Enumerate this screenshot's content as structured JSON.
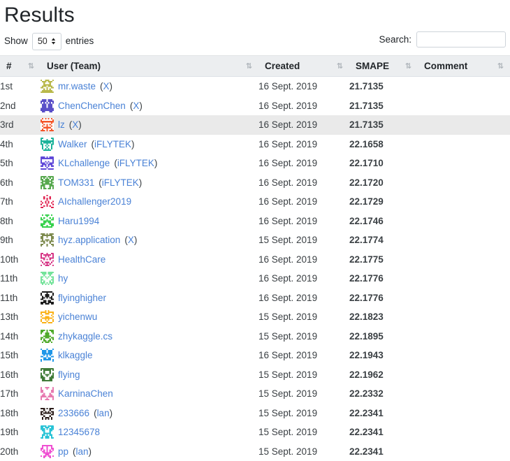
{
  "page_title": "Results",
  "controls": {
    "show_label": "Show",
    "entries_label": "entries",
    "page_length": "50",
    "search_label": "Search:",
    "search_value": "",
    "search_placeholder": ""
  },
  "table": {
    "columns": [
      {
        "key": "rank",
        "label": "#"
      },
      {
        "key": "user",
        "label": "User (Team)"
      },
      {
        "key": "created",
        "label": "Created"
      },
      {
        "key": "smape",
        "label": "SMAPE"
      },
      {
        "key": "comment",
        "label": "Comment"
      }
    ],
    "sort_icon": "⇅",
    "rows": [
      {
        "rank": "1st",
        "user": "mr.waste",
        "team": "X",
        "created": "16 Sept. 2019",
        "smape": "21.7135",
        "comment": "",
        "avatar_color": "#b8b84a",
        "highlight": false
      },
      {
        "rank": "2nd",
        "user": "ChenChenChen",
        "team": "X",
        "created": "16 Sept. 2019",
        "smape": "21.7135",
        "comment": "",
        "avatar_color": "#5a4fc8",
        "highlight": false
      },
      {
        "rank": "3rd",
        "user": "lz",
        "team": "X",
        "created": "16 Sept. 2019",
        "smape": "21.7135",
        "comment": "",
        "avatar_color": "#f4562a",
        "highlight": true
      },
      {
        "rank": "4th",
        "user": "Walker",
        "team": "iFLYTEK",
        "created": "16 Sept. 2019",
        "smape": "22.1658",
        "comment": "",
        "avatar_color": "#1bb39a",
        "highlight": false
      },
      {
        "rank": "5th",
        "user": "KLchallenge",
        "team": "iFLYTEK",
        "created": "16 Sept. 2019",
        "smape": "22.1710",
        "comment": "",
        "avatar_color": "#5f48d8",
        "highlight": false
      },
      {
        "rank": "6th",
        "user": "TOM331",
        "team": "iFLYTEK",
        "created": "16 Sept. 2019",
        "smape": "22.1720",
        "comment": "",
        "avatar_color": "#57a84e",
        "highlight": false
      },
      {
        "rank": "7th",
        "user": "AIchallenger2019",
        "team": "",
        "created": "16 Sept. 2019",
        "smape": "22.1729",
        "comment": "",
        "avatar_color": "#e0214f",
        "highlight": false
      },
      {
        "rank": "8th",
        "user": "Haru1994",
        "team": "",
        "created": "16 Sept. 2019",
        "smape": "22.1746",
        "comment": "",
        "avatar_color": "#35d14b",
        "highlight": false
      },
      {
        "rank": "9th",
        "user": "hyz.application",
        "team": "X",
        "created": "15 Sept. 2019",
        "smape": "22.1774",
        "comment": "",
        "avatar_color": "#7d8a4e",
        "highlight": false
      },
      {
        "rank": "10th",
        "user": "HealthCare",
        "team": "",
        "created": "16 Sept. 2019",
        "smape": "22.1775",
        "comment": "",
        "avatar_color": "#d63384",
        "highlight": false
      },
      {
        "rank": "11th",
        "user": "hy",
        "team": "",
        "created": "16 Sept. 2019",
        "smape": "22.1776",
        "comment": "",
        "avatar_color": "#74e39a",
        "highlight": false
      },
      {
        "rank": "11th",
        "user": "flyinghigher",
        "team": "",
        "created": "16 Sept. 2019",
        "smape": "22.1776",
        "comment": "",
        "avatar_color": "#1c1c1c",
        "highlight": false
      },
      {
        "rank": "13th",
        "user": "yichenwu",
        "team": "",
        "created": "15 Sept. 2019",
        "smape": "22.1823",
        "comment": "",
        "avatar_color": "#fbb216",
        "highlight": false
      },
      {
        "rank": "14th",
        "user": "zhykaggle.cs",
        "team": "",
        "created": "15 Sept. 2019",
        "smape": "22.1895",
        "comment": "",
        "avatar_color": "#4faa2a",
        "highlight": false
      },
      {
        "rank": "15th",
        "user": "klkaggle",
        "team": "",
        "created": "16 Sept. 2019",
        "smape": "22.1943",
        "comment": "",
        "avatar_color": "#1e96e8",
        "highlight": false
      },
      {
        "rank": "16th",
        "user": "flying",
        "team": "",
        "created": "15 Sept. 2019",
        "smape": "22.1962",
        "comment": "",
        "avatar_color": "#3f7a38",
        "highlight": false
      },
      {
        "rank": "17th",
        "user": "KarninaChen",
        "team": "",
        "created": "15 Sept. 2019",
        "smape": "22.2332",
        "comment": "",
        "avatar_color": "#e77ab0",
        "highlight": false
      },
      {
        "rank": "18th",
        "user": "233666",
        "team": "lan",
        "created": "15 Sept. 2019",
        "smape": "22.2341",
        "comment": "",
        "avatar_color": "#2b1d1a",
        "highlight": false
      },
      {
        "rank": "19th",
        "user": "12345678",
        "team": "",
        "created": "15 Sept. 2019",
        "smape": "22.2341",
        "comment": "",
        "avatar_color": "#29c3d6",
        "highlight": false
      },
      {
        "rank": "20th",
        "user": "pp",
        "team": "lan",
        "created": "15 Sept. 2019",
        "smape": "22.2341",
        "comment": "",
        "avatar_color": "#ef4fd2",
        "highlight": false
      }
    ]
  },
  "colors": {
    "link": "#4a82d6",
    "smape": "#1273e6",
    "header_bg": "#eceef0",
    "row_highlight": "#eaeaea"
  }
}
